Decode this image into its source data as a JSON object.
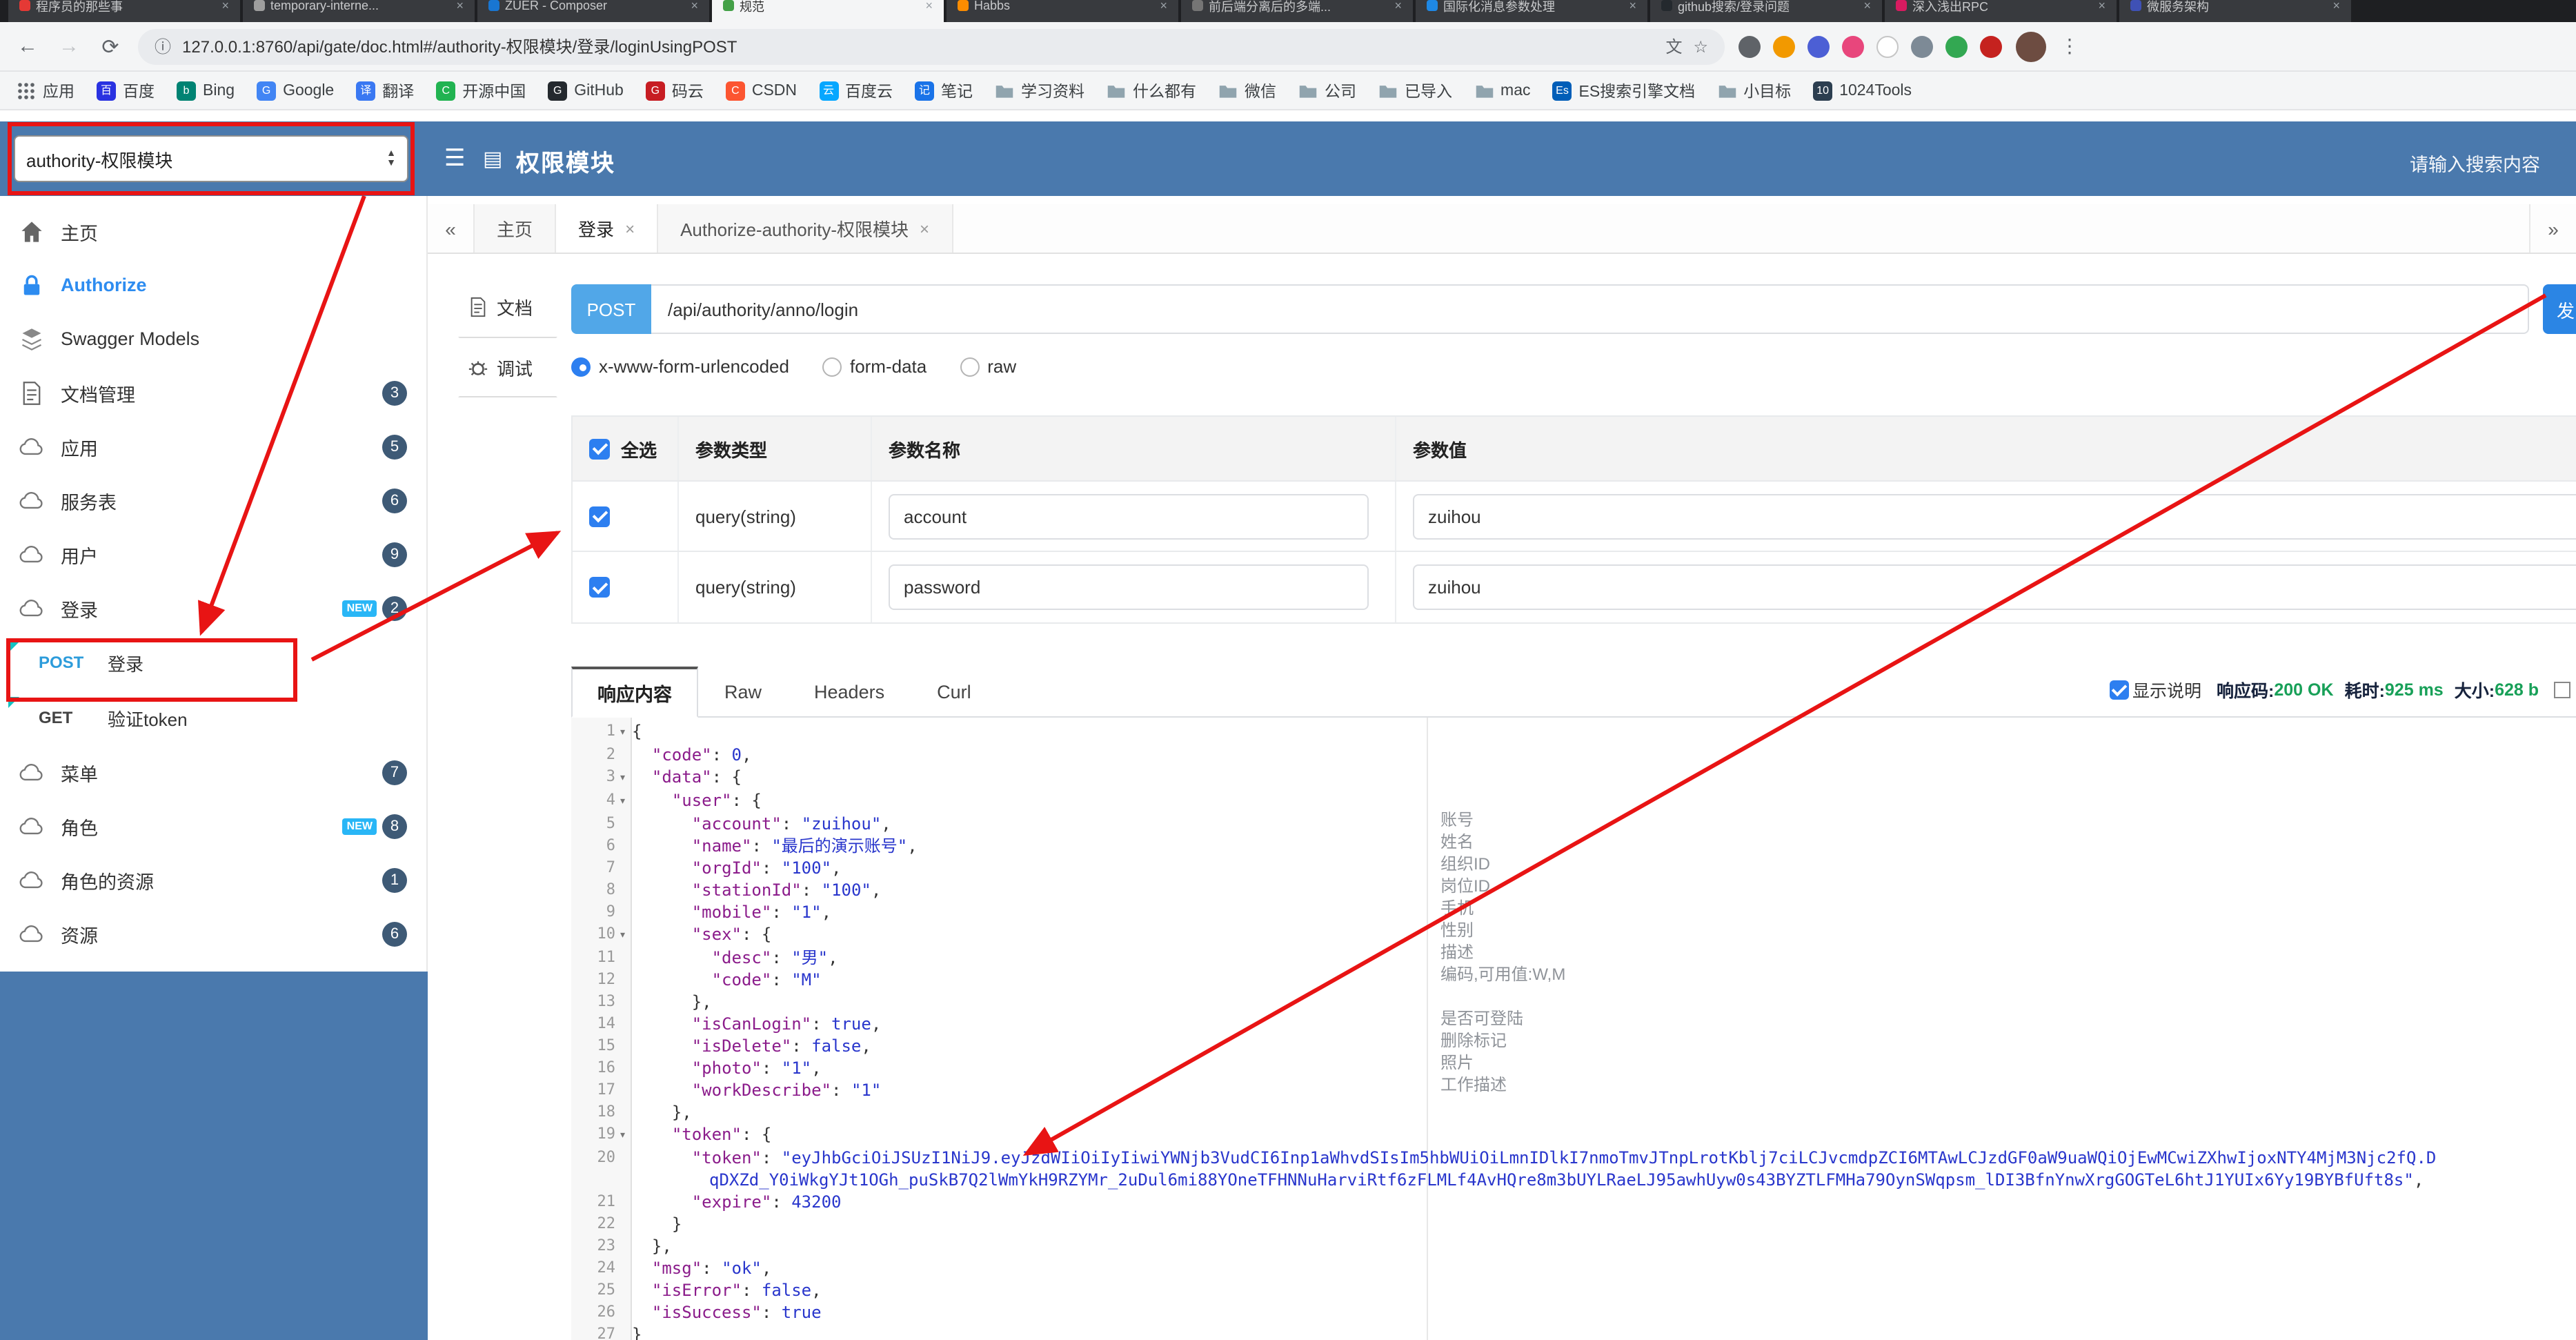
{
  "browser": {
    "tabs": [
      {
        "title": "程序员的那些事",
        "color": "#e53935",
        "active": false
      },
      {
        "title": "temporary-interne...",
        "color": "#9e9e9e",
        "active": false
      },
      {
        "title": "ZUER - Composer",
        "color": "#1976d2",
        "active": false
      },
      {
        "title": "规范",
        "color": "#43a047",
        "active": true
      },
      {
        "title": "Habbs",
        "color": "#fb8c00",
        "active": false
      },
      {
        "title": "前后端分离后的多端...",
        "color": "#757575",
        "active": false
      },
      {
        "title": "国际化消息参数处理",
        "color": "#1e88e5",
        "active": false
      },
      {
        "title": "github搜索/登录问题",
        "color": "#24292e",
        "active": false
      },
      {
        "title": "深入浅出RPC",
        "color": "#d81b60",
        "active": false
      },
      {
        "title": "微服务架构",
        "color": "#3f51b5",
        "active": false
      }
    ],
    "url": "127.0.0.1:8760/api/gate/doc.html#/authority-权限模块/登录/loginUsingPOST",
    "extensions": [
      {
        "color": "#5f6368"
      },
      {
        "color": "#f29900"
      },
      {
        "color": "#4c5fd5"
      },
      {
        "color": "#e8467c"
      },
      {
        "color": "#ffffff"
      },
      {
        "color": "#7d8a96"
      },
      {
        "color": "#33a852"
      },
      {
        "color": "#c5221f"
      }
    ],
    "bookmarks": [
      {
        "label": "应用",
        "icon": "apps"
      },
      {
        "label": "百度",
        "icon": "fav",
        "color": "#2932e1",
        "letter": "百"
      },
      {
        "label": "Bing",
        "icon": "fav",
        "color": "#008373",
        "letter": "b"
      },
      {
        "label": "Google",
        "icon": "fav",
        "color": "#4285f4",
        "letter": "G"
      },
      {
        "label": "翻译",
        "icon": "fav",
        "color": "#3a78f2",
        "letter": "译"
      },
      {
        "label": "开源中国",
        "icon": "fav",
        "color": "#21b351",
        "letter": "C"
      },
      {
        "label": "GitHub",
        "icon": "fav",
        "color": "#24292e",
        "letter": "G"
      },
      {
        "label": "码云",
        "icon": "fav",
        "color": "#c71d23",
        "letter": "G"
      },
      {
        "label": "CSDN",
        "icon": "fav",
        "color": "#fc5531",
        "letter": "C"
      },
      {
        "label": "百度云",
        "icon": "fav",
        "color": "#06a7ff",
        "letter": "云"
      },
      {
        "label": "笔记",
        "icon": "fav",
        "color": "#1a73e8",
        "letter": "记"
      },
      {
        "label": "学习资料",
        "icon": "folder"
      },
      {
        "label": "什么都有",
        "icon": "folder"
      },
      {
        "label": "微信",
        "icon": "folder"
      },
      {
        "label": "公司",
        "icon": "folder"
      },
      {
        "label": "已导入",
        "icon": "folder"
      },
      {
        "label": "mac",
        "icon": "folder"
      },
      {
        "label": "ES搜索引擎文档",
        "icon": "fav",
        "color": "#005eb8",
        "letter": "Es"
      },
      {
        "label": "小目标",
        "icon": "folder"
      },
      {
        "label": "1024Tools",
        "icon": "fav",
        "color": "#2c3e50",
        "letter": "10"
      }
    ]
  },
  "header": {
    "group": "authority-权限模块",
    "title": "权限模块",
    "search_placeholder": "请输入搜索内容"
  },
  "sidebar": {
    "new_label": "NEW",
    "items_top": [
      {
        "label": "主页",
        "icon": "home"
      },
      {
        "label": "Authorize",
        "icon": "lock",
        "accent": true
      },
      {
        "label": "Swagger Models",
        "icon": "models"
      },
      {
        "label": "文档管理",
        "icon": "doc",
        "badge": "3"
      },
      {
        "label": "应用",
        "icon": "cloud",
        "badge": "5"
      },
      {
        "label": "服务表",
        "icon": "cloud",
        "badge": "6"
      },
      {
        "label": "用户",
        "icon": "cloud",
        "badge": "9"
      },
      {
        "label": "登录",
        "icon": "cloud",
        "badge": "2",
        "isNew": true
      }
    ],
    "sub_items": [
      {
        "method": "POST",
        "label": "登录",
        "highlight": true
      },
      {
        "method": "GET",
        "label": "验证token"
      }
    ],
    "items_bottom": [
      {
        "label": "菜单",
        "icon": "cloud",
        "badge": "7"
      },
      {
        "label": "角色",
        "icon": "cloud",
        "badge": "8",
        "isNew": true
      },
      {
        "label": "角色的资源",
        "icon": "cloud",
        "badge": "1"
      },
      {
        "label": "资源",
        "icon": "cloud",
        "badge": "6"
      }
    ]
  },
  "content": {
    "scroll_left": "«",
    "scroll_right": "»",
    "tabs": [
      {
        "label": "主页",
        "closable": false,
        "active": false
      },
      {
        "label": "登录",
        "closable": true,
        "active": true
      },
      {
        "label": "Authorize-authority-权限模块",
        "closable": true,
        "active": false
      }
    ],
    "doc_tabs": [
      {
        "label": "文档",
        "icon": "file",
        "active": false
      },
      {
        "label": "调试",
        "icon": "debug",
        "active": true
      }
    ]
  },
  "request": {
    "method": "POST",
    "url": "/api/authority/anno/login",
    "send_label": "发",
    "body_types": [
      {
        "label": "x-www-form-urlencoded",
        "selected": true
      },
      {
        "label": "form-data",
        "selected": false
      },
      {
        "label": "raw",
        "selected": false
      }
    ],
    "params": {
      "headers": [
        "全选",
        "参数类型",
        "参数名称",
        "参数值"
      ],
      "rows": [
        {
          "checked": true,
          "type": "query(string)",
          "name": "account",
          "value": "zuihou"
        },
        {
          "checked": true,
          "type": "query(string)",
          "name": "password",
          "value": "zuihou"
        }
      ]
    }
  },
  "response": {
    "tabs": [
      "响应内容",
      "Raw",
      "Headers",
      "Curl"
    ],
    "active_tab": "响应内容",
    "show_desc_label": "显示说明",
    "show_desc_checked": true,
    "meta": [
      {
        "label": "响应码:",
        "value": "200 OK"
      },
      {
        "label": "耗时:",
        "value": "925 ms"
      },
      {
        "label": "大小:",
        "value": "628 b"
      }
    ],
    "fold_lines": [
      1,
      3,
      4,
      10,
      19
    ],
    "body_lines": [
      "{",
      "  \"code\": 0,",
      "  \"data\": {",
      "    \"user\": {",
      "      \"account\": \"zuihou\",",
      "      \"name\": \"最后的演示账号\",",
      "      \"orgId\": \"100\",",
      "      \"stationId\": \"100\",",
      "      \"mobile\": \"1\",",
      "      \"sex\": {",
      "        \"desc\": \"男\",",
      "        \"code\": \"M\"",
      "      },",
      "      \"isCanLogin\": true,",
      "      \"isDelete\": false,",
      "      \"photo\": \"1\",",
      "      \"workDescribe\": \"1\"",
      "    },",
      "    \"token\": {",
      "      \"token\": \"eyJhbGciOiJSUzI1NiJ9.eyJzdWIiOiIyIiwiYWNjb3VudCI6Inp1aWhvdSIsIm5hbWUiOiLmnIDlkI7nmoTmvJTnpLrotKblj7ciLCJvcmdpZCI6MTAwLCJzdGF0aW9uaWQiOjEwMCwiZXhwIjoxNTY4MjM3Njc2fQ.DqDXZd_Y0iWkgYJt1OGh_puSkB7Q2lWmYkH9RZYMr_2uDul6mi88YOneTFHNNuHarviRtf6zFLMLf4AvHQre8m3bUYLRaeLJ95awhUyw0s43BYZTLFMHa79OynSWqpsm_lDI3BfnYnwXrgGOGTeL6htJ1YUIx6Yy19BYBfUft8s\",",
      "      \"expire\": 43200",
      "    }",
      "  },",
      "  \"msg\": \"ok\",",
      "  \"isError\": false,",
      "  \"isSuccess\": true",
      "}"
    ],
    "annotations": [
      {
        "line": 5,
        "text": "账号"
      },
      {
        "line": 6,
        "text": "姓名"
      },
      {
        "line": 7,
        "text": "组织ID"
      },
      {
        "line": 8,
        "text": "岗位ID"
      },
      {
        "line": 9,
        "text": "手机"
      },
      {
        "line": 10,
        "text": "性别"
      },
      {
        "line": 11,
        "text": "描述"
      },
      {
        "line": 12,
        "text": "编码,可用值:W,M"
      },
      {
        "line": 14,
        "text": "是否可登陆"
      },
      {
        "line": 15,
        "text": "删除标记"
      },
      {
        "line": 16,
        "text": "照片"
      },
      {
        "line": 17,
        "text": "工作描述"
      }
    ]
  }
}
